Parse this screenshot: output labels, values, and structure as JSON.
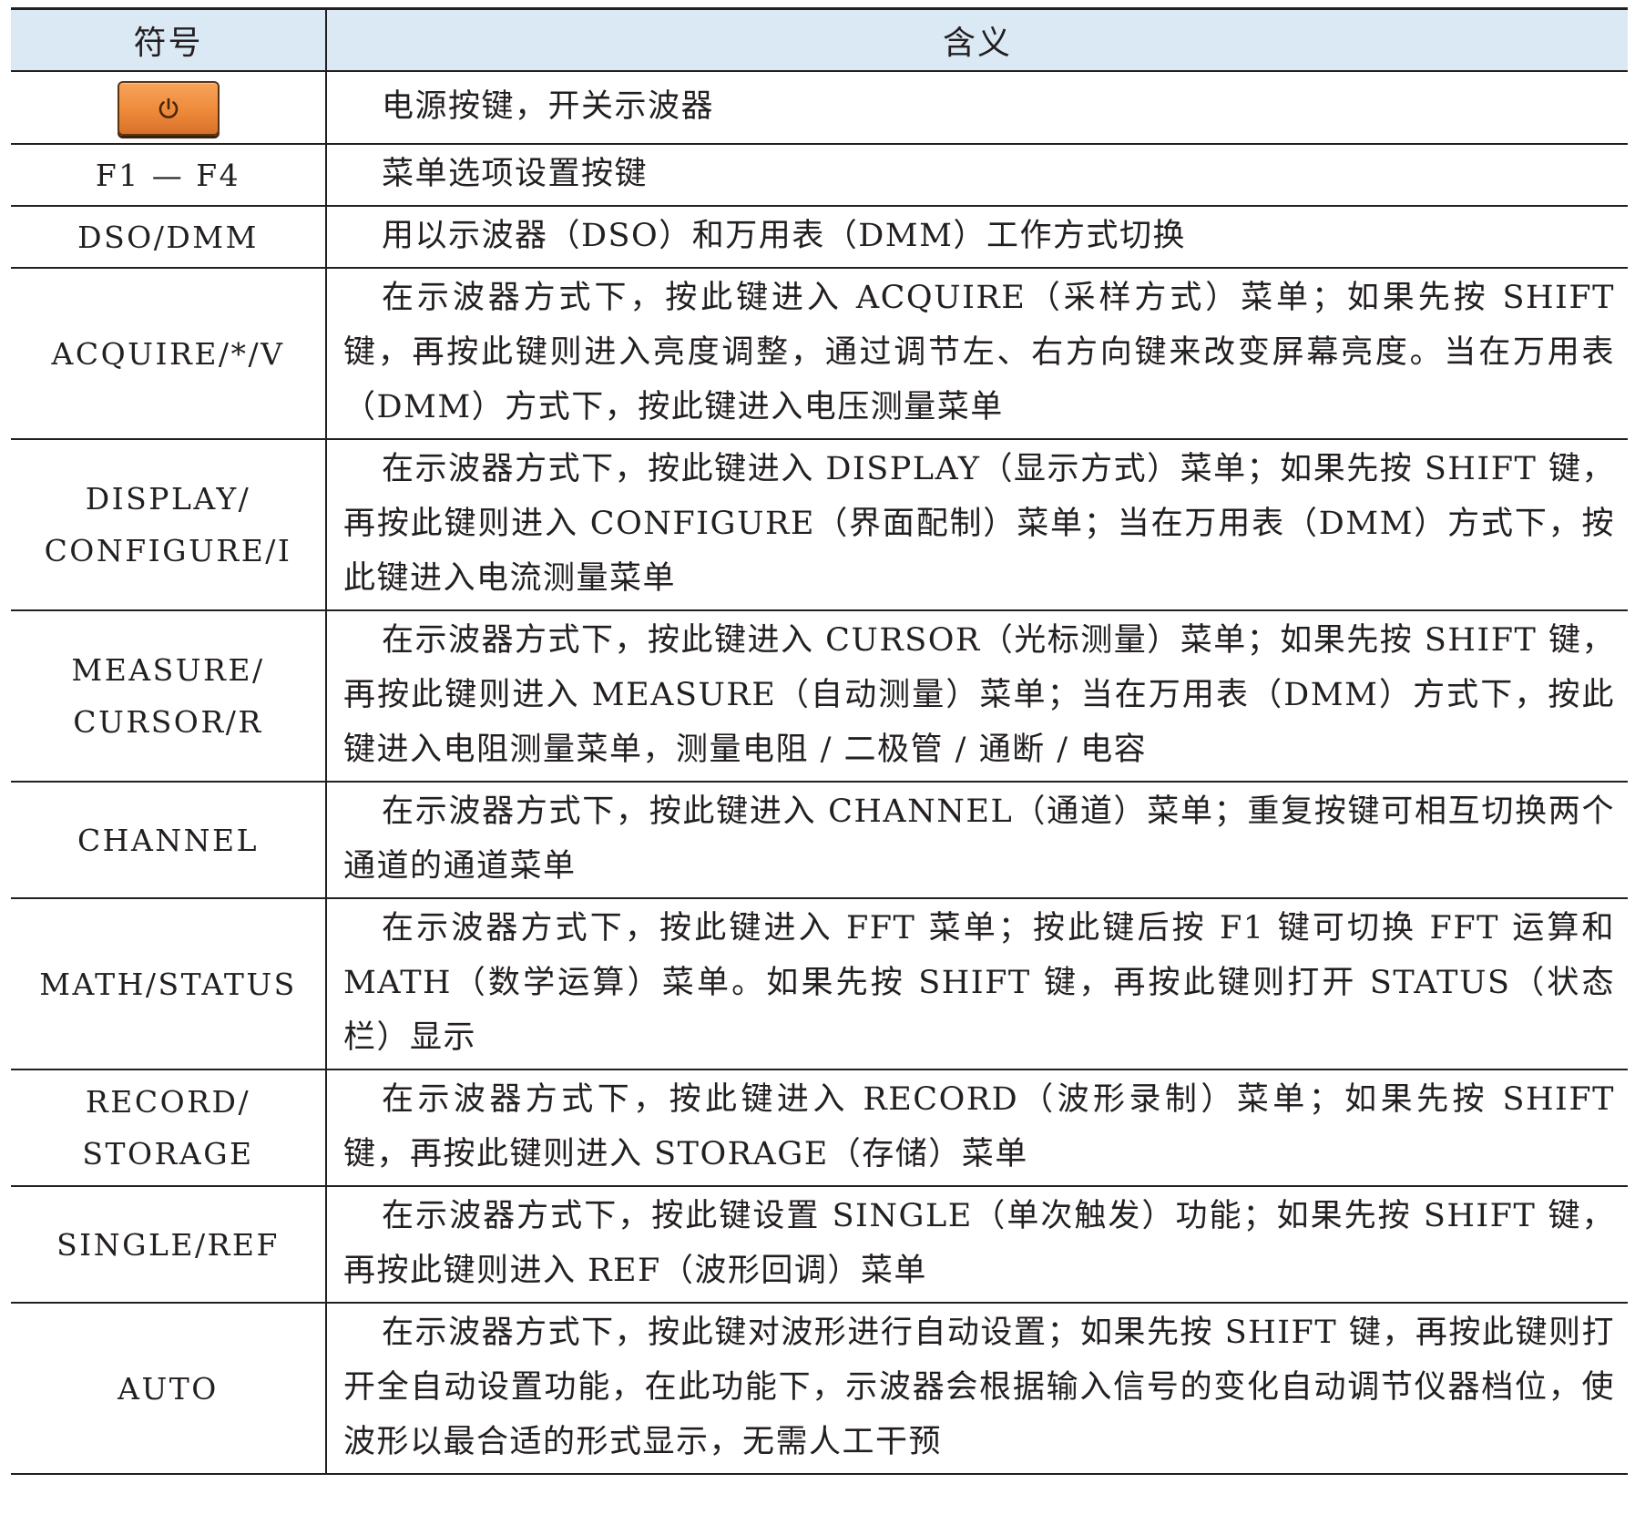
{
  "header": {
    "symbol": "符号",
    "meaning": "含义"
  },
  "rows": [
    {
      "symbol": "",
      "icon": "power-icon",
      "meaning": "电源按键，开关示波器"
    },
    {
      "symbol": "F1 — F4",
      "meaning": "菜单选项设置按键"
    },
    {
      "symbol": "DSO/DMM",
      "meaning": "用以示波器（DSO）和万用表（DMM）工作方式切换"
    },
    {
      "symbol": "ACQUIRE/*/V",
      "meaning": "在示波器方式下，按此键进入 ACQUIRE（采样方式）菜单；如果先按 SHIFT 键，再按此键则进入亮度调整，通过调节左、右方向键来改变屏幕亮度。当在万用表（DMM）方式下，按此键进入电压测量菜单"
    },
    {
      "symbol_line1": "DISPLAY/",
      "symbol_line2": "CONFIGURE/I",
      "meaning": "在示波器方式下，按此键进入 DISPLAY（显示方式）菜单；如果先按 SHIFT 键，再按此键则进入 CONFIGURE（界面配制）菜单；当在万用表（DMM）方式下，按此键进入电流测量菜单"
    },
    {
      "symbol_line1": "MEASURE/",
      "symbol_line2": "CURSOR/R",
      "meaning": "在示波器方式下，按此键进入 CURSOR（光标测量）菜单；如果先按 SHIFT 键，再按此键则进入 MEASURE（自动测量）菜单；当在万用表（DMM）方式下，按此键进入电阻测量菜单，测量电阻 / 二极管 / 通断 / 电容"
    },
    {
      "symbol": "CHANNEL",
      "meaning": "在示波器方式下，按此键进入 CHANNEL（通道）菜单；重复按键可相互切换两个通道的通道菜单"
    },
    {
      "symbol": "MATH/STATUS",
      "meaning": "在示波器方式下，按此键进入 FFT 菜单；按此键后按 F1 键可切换 FFT 运算和 MATH（数学运算）菜单。如果先按 SHIFT 键，再按此键则打开 STATUS（状态栏）显示"
    },
    {
      "symbol_line1": "RECORD/",
      "symbol_line2": "STORAGE",
      "meaning": "在示波器方式下，按此键进入 RECORD（波形录制）菜单；如果先按 SHIFT 键，再按此键则进入 STORAGE（存储）菜单"
    },
    {
      "symbol": "SINGLE/REF",
      "meaning": "在示波器方式下，按此键设置 SINGLE（单次触发）功能；如果先按 SHIFT 键，再按此键则进入 REF（波形回调）菜单"
    },
    {
      "symbol": "AUTO",
      "meaning": "在示波器方式下，按此键对波形进行自动设置；如果先按 SHIFT 键，再按此键则打开全自动设置功能，在此功能下，示波器会根据输入信号的变化自动调节仪器档位，使波形以最合适的形式显示，无需人工干预"
    }
  ],
  "colors": {
    "header_bg": "#dbe9f5",
    "power_button": "#ee8a3a",
    "rule": "#231f20"
  }
}
